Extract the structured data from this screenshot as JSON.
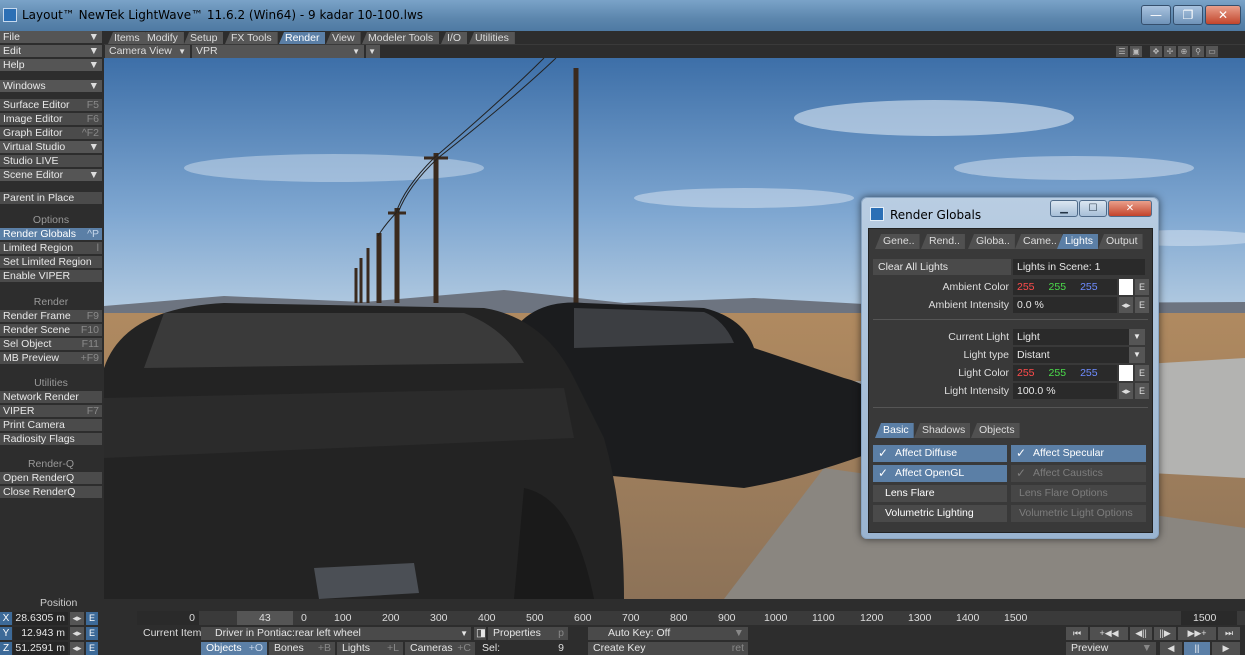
{
  "window": {
    "title": "Layout™ NewTek LightWave™ 11.6.2 (Win64) - 9 kadar 10-100.lws",
    "minimize": "—",
    "maximize": "❐",
    "close": "✕"
  },
  "menu_tabs": [
    "Items",
    "Modify",
    "Setup",
    "FX Tools",
    "Render",
    "View",
    "Modeler Tools",
    "I/O",
    "Utilities"
  ],
  "viewport": {
    "view_mode": "Camera View",
    "render_mode": "VPR"
  },
  "sidebar": {
    "top": [
      {
        "label": "File",
        "key": "▼"
      },
      {
        "label": "Edit",
        "key": "▼"
      },
      {
        "label": "Help",
        "key": "▼"
      },
      {
        "label": "Windows",
        "key": "▼"
      }
    ],
    "editors": [
      {
        "label": "Surface Editor",
        "key": "F5"
      },
      {
        "label": "Image Editor",
        "key": "F6"
      },
      {
        "label": "Graph Editor",
        "key": "^F2"
      },
      {
        "label": "Virtual Studio",
        "key": "▼"
      },
      {
        "label": "Studio LIVE",
        "key": ""
      },
      {
        "label": "Scene Editor",
        "key": "▼"
      }
    ],
    "parent_in_place": "Parent in Place",
    "options_header": "Options",
    "options": [
      {
        "label": "Render Globals",
        "key": "^P"
      },
      {
        "label": "Limited Region",
        "key": "l"
      },
      {
        "label": "Set Limited Region",
        "key": ""
      },
      {
        "label": "Enable VIPER",
        "key": ""
      }
    ],
    "render_header": "Render",
    "render": [
      {
        "label": "Render Frame",
        "key": "F9"
      },
      {
        "label": "Render Scene",
        "key": "F10"
      },
      {
        "label": "Sel Object",
        "key": "F11"
      },
      {
        "label": "MB Preview",
        "key": "+F9"
      }
    ],
    "utilities_header": "Utilities",
    "utilities": [
      {
        "label": "Network Render",
        "key": ""
      },
      {
        "label": "VIPER",
        "key": "F7"
      },
      {
        "label": "Print Camera",
        "key": ""
      },
      {
        "label": "Radiosity Flags",
        "key": ""
      }
    ],
    "renderq_header": "Render-Q",
    "renderq": [
      {
        "label": "Open RenderQ",
        "key": ""
      },
      {
        "label": "Close RenderQ",
        "key": ""
      }
    ]
  },
  "render_globals": {
    "title": "Render Globals",
    "tabs": [
      "Gene..",
      "Rend..",
      "Globa..",
      "Came..",
      "Lights",
      "Output"
    ],
    "clear_all_lights": "Clear All Lights",
    "lights_in_scene": "Lights in Scene: 1",
    "ambient_color_label": "Ambient Color",
    "ambient_color": {
      "r": "255",
      "g": "255",
      "b": "255"
    },
    "ambient_intensity_label": "Ambient Intensity",
    "ambient_intensity": "0.0 %",
    "current_light_label": "Current Light",
    "current_light": "Light",
    "light_type_label": "Light type",
    "light_type": "Distant",
    "light_color_label": "Light Color",
    "light_color": {
      "r": "255",
      "g": "255",
      "b": "255"
    },
    "light_intensity_label": "Light Intensity",
    "light_intensity": "100.0 %",
    "env_button": "E",
    "sub_tabs": [
      "Basic",
      "Shadows",
      "Objects"
    ],
    "affect_diffuse": "Affect Diffuse",
    "affect_specular": "Affect Specular",
    "affect_opengl": "Affect OpenGL",
    "affect_caustics": "Affect Caustics",
    "lens_flare": "Lens Flare",
    "lens_flare_options": "Lens Flare Options",
    "volumetric_lighting": "Volumetric Lighting",
    "volumetric_light_options": "Volumetric Light Options",
    "colors": {
      "red": "#ff4b4b",
      "green": "#4bdc4b",
      "blue": "#6e8cff",
      "accent": "#5b7fa6"
    }
  },
  "position": {
    "label": "Position",
    "x_axis": "X",
    "y_axis": "Y",
    "z_axis": "Z",
    "x": "28.6305 m",
    "y": "12.943 m",
    "z": "51.2591 m",
    "env": "E"
  },
  "timeline": {
    "start_frame": "0",
    "current_frame": "43",
    "marks": [
      "0",
      "100",
      "200",
      "300",
      "400",
      "500",
      "600",
      "700",
      "800",
      "900",
      "1000",
      "1100",
      "1200",
      "1300",
      "1400",
      "1500"
    ],
    "end_frame": "1500"
  },
  "bottom": {
    "current_item_label": "Current Item",
    "current_item": "Driver in Pontiac:rear left wheel",
    "properties": "Properties",
    "properties_key": "p",
    "auto_key": "Auto Key: Off",
    "objects": "Objects",
    "objects_key": "+O",
    "bones": "Bones",
    "bones_key": "+B",
    "lights": "Lights",
    "lights_key": "+L",
    "cameras": "Cameras",
    "cameras_key": "+C",
    "sel_label": "Sel:",
    "sel_value": "9",
    "create_key": "Create Key",
    "create_key_key": "ret",
    "preview": "Preview"
  }
}
